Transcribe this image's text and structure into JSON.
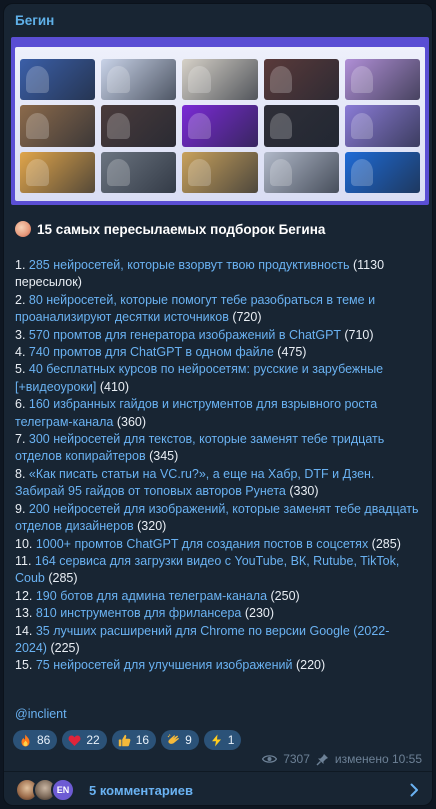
{
  "channel": {
    "name": "Бегин"
  },
  "banner": {
    "border_color": "#5a4ed4",
    "thumb_colors": [
      "#3b5fa8",
      "#c9d3e8",
      "#d6d1c8",
      "#5a3a3a",
      "#b08fd6",
      "#8b6a4b",
      "#4a3b3b",
      "#7b2ad6",
      "#2f2f38",
      "#8a7bd6",
      "#e0a54b",
      "#6b7480",
      "#c8a15c",
      "#b0b8c8",
      "#1f6bd6"
    ]
  },
  "post": {
    "title_emoji": "face-emoji",
    "title": "15 самых пересылаемых подборок Бегина",
    "items": [
      {
        "num": "1. ",
        "link": "285 нейросетей, которые взорвут твою продуктивность",
        "count": " (1130 пересылок)"
      },
      {
        "num": "2. ",
        "link": "80 нейросетей, которые помогут тебе разобраться в теме и проанализируют десятки источников",
        "count": " (720)"
      },
      {
        "num": "3. ",
        "link": "570 промтов для генератора изображений в ChatGPT",
        "count": " (710)"
      },
      {
        "num": "4. ",
        "link": "740 промтов для ChatGPT в одном файле",
        "count": " (475)"
      },
      {
        "num": "5. ",
        "link": "40 бесплатных курсов по нейросетям: русские и зарубежные [+видеоуроки]",
        "count": " (410)"
      },
      {
        "num": "6. ",
        "link": "160 избранных гайдов и инструментов для взрывного роста телеграм-канала",
        "count": " (360)"
      },
      {
        "num": "7. ",
        "link": "300 нейросетей для текстов, которые заменят тебе тридцать отделов копирайтеров",
        "count": " (345)"
      },
      {
        "num": "8. ",
        "link": "«Как писать статьи на VC.ru?», а еще на Хабр, DTF и Дзен. Забирай 95 гайдов от топовых авторов Рунета",
        "count": " (330)"
      },
      {
        "num": "9. ",
        "link": "200 нейросетей для изображений, которые заменят тебе двадцать отделов дизайнеров",
        "count": " (320)"
      },
      {
        "num": "10. ",
        "link": "1000+ промтов ChatGPT для создания постов в соцсетях",
        "count": " (285)"
      },
      {
        "num": "11. ",
        "link": "164 сервиса для загрузки видео с YouTube, ВК, Rutube, TikTok, Coub",
        "count": " (285)"
      },
      {
        "num": "12. ",
        "link": "190 ботов для админа телеграм-канала",
        "count": " (250)"
      },
      {
        "num": "13. ",
        "link": "810 инструментов для фрилансера",
        "count": " (230)"
      },
      {
        "num": "14. ",
        "link": "35 лучших расширений для Chrome по версии Google (2022-2024)",
        "count": " (225)"
      },
      {
        "num": "15. ",
        "link": "75 нейросетей для улучшения изображений",
        "count": " (220)"
      }
    ],
    "handle": "@inclient"
  },
  "reactions": [
    {
      "icon": "fire-icon",
      "count": "86"
    },
    {
      "icon": "heart-icon",
      "count": "22"
    },
    {
      "icon": "thumbs-up-icon",
      "count": "16"
    },
    {
      "icon": "clap-icon",
      "count": "9"
    },
    {
      "icon": "lightning-icon",
      "count": "1"
    }
  ],
  "meta": {
    "views": "7307",
    "edited": "изменено 10:55"
  },
  "comments": {
    "label": "5 комментариев",
    "avatar_initials": "EN"
  }
}
